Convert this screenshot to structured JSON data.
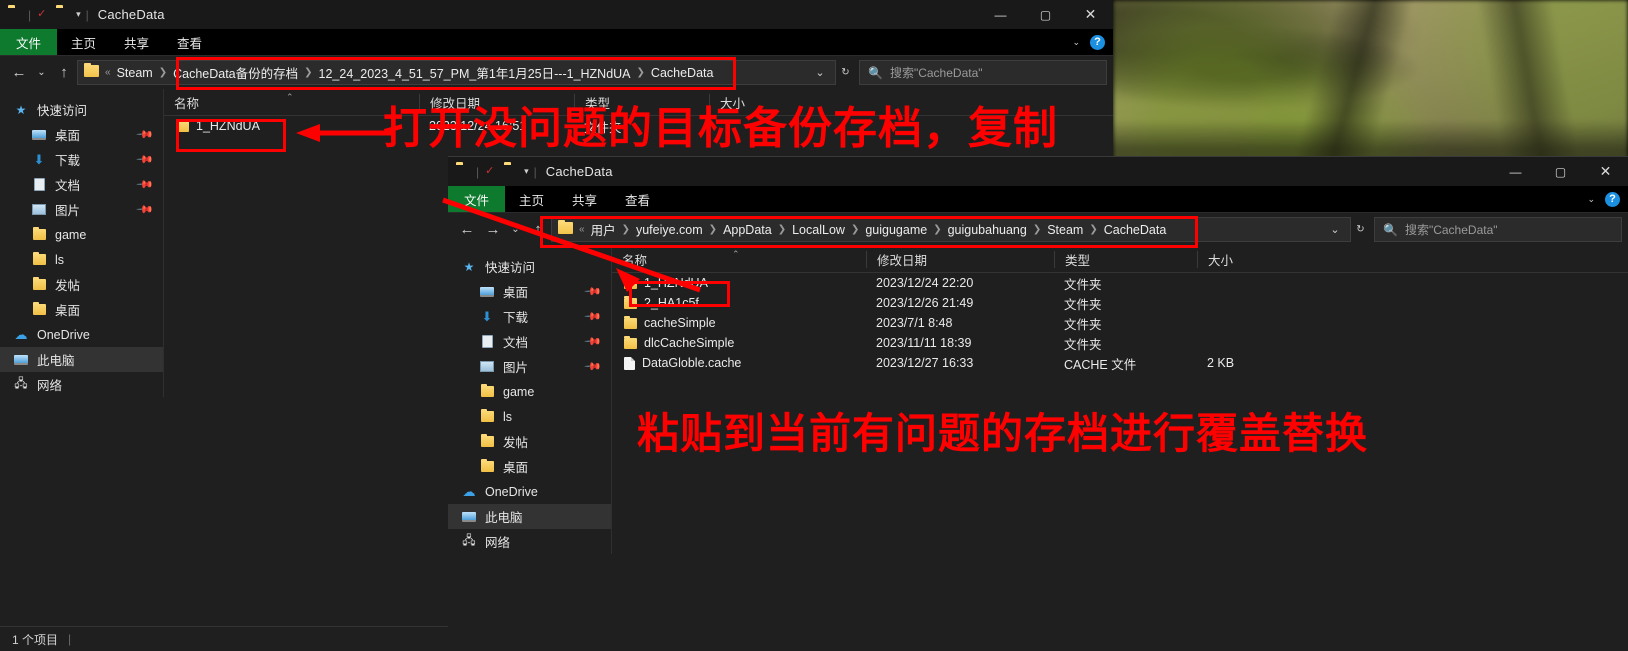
{
  "window1": {
    "title": "CacheData",
    "quick_access_icons": [
      "folder-icon",
      "properties-icon",
      "new-folder-icon",
      "customize-chevron-icon"
    ],
    "ribbon_tabs": [
      "文件",
      "主页",
      "共享",
      "查看"
    ],
    "window_buttons": {
      "minimize": "—",
      "maximize": "▢",
      "close": "✕"
    },
    "help_icon": "?",
    "nav": {
      "back": "←",
      "forward": "→",
      "recent": "⌄",
      "up": "↑"
    },
    "breadcrumbs": [
      "Steam",
      "CacheData备份的存档",
      "12_24_2023_4_51_57_PM_第1年1月25日---1_HZNdUA",
      "CacheData"
    ],
    "addr_prefix": "«",
    "addr_dropdown": "⌄",
    "refresh": "↻",
    "search_placeholder": "搜索\"CacheData\"",
    "sidebar": [
      {
        "label": "快速访问",
        "icon": "star-icon",
        "pinned": false,
        "indent": false,
        "selected": false
      },
      {
        "label": "桌面",
        "icon": "desktop-icon",
        "pinned": true,
        "indent": true,
        "selected": false
      },
      {
        "label": "下载",
        "icon": "download-icon",
        "pinned": true,
        "indent": true,
        "selected": false
      },
      {
        "label": "文档",
        "icon": "document-icon",
        "pinned": true,
        "indent": true,
        "selected": false
      },
      {
        "label": "图片",
        "icon": "pictures-icon",
        "pinned": true,
        "indent": true,
        "selected": false
      },
      {
        "label": "game",
        "icon": "folder-icon",
        "pinned": false,
        "indent": true,
        "selected": false
      },
      {
        "label": "ls",
        "icon": "folder-icon",
        "pinned": false,
        "indent": true,
        "selected": false
      },
      {
        "label": "发帖",
        "icon": "folder-icon",
        "pinned": false,
        "indent": true,
        "selected": false
      },
      {
        "label": "桌面",
        "icon": "folder-icon",
        "pinned": false,
        "indent": true,
        "selected": false
      },
      {
        "label": "OneDrive",
        "icon": "cloud-icon",
        "pinned": false,
        "indent": false,
        "selected": false
      },
      {
        "label": "此电脑",
        "icon": "this-pc-icon",
        "pinned": false,
        "indent": false,
        "selected": true
      },
      {
        "label": "网络",
        "icon": "network-icon",
        "pinned": false,
        "indent": false,
        "selected": false
      }
    ],
    "columns": [
      "名称",
      "修改日期",
      "类型",
      "大小"
    ],
    "rows": [
      {
        "name": "1_HZNdUA",
        "modified": "2023/12/24 16:51",
        "type": "文件夹",
        "size": "",
        "icon": "folder-icon",
        "highlighted": true
      }
    ],
    "status": {
      "count": "1 个项目",
      "extra": ""
    }
  },
  "window2": {
    "title": "CacheData",
    "ribbon_tabs": [
      "文件",
      "主页",
      "共享",
      "查看"
    ],
    "window_buttons": {
      "minimize": "—",
      "maximize": "▢",
      "close": "✕"
    },
    "help_icon": "?",
    "nav": {
      "back": "←",
      "forward": "→",
      "recent": "⌄",
      "up": "↑"
    },
    "breadcrumbs": [
      "用户",
      "yufeiye.com",
      "AppData",
      "LocalLow",
      "guigugame",
      "guigubahuang",
      "Steam",
      "CacheData"
    ],
    "addr_prefix": "«",
    "addr_dropdown": "⌄",
    "refresh": "↻",
    "search_placeholder": "搜索\"CacheData\"",
    "sidebar": [
      {
        "label": "快速访问",
        "icon": "star-icon",
        "pinned": false,
        "indent": false,
        "selected": false
      },
      {
        "label": "桌面",
        "icon": "desktop-icon",
        "pinned": true,
        "indent": true,
        "selected": false
      },
      {
        "label": "下载",
        "icon": "download-icon",
        "pinned": true,
        "indent": true,
        "selected": false
      },
      {
        "label": "文档",
        "icon": "document-icon",
        "pinned": true,
        "indent": true,
        "selected": false
      },
      {
        "label": "图片",
        "icon": "pictures-icon",
        "pinned": true,
        "indent": true,
        "selected": false
      },
      {
        "label": "game",
        "icon": "folder-icon",
        "pinned": false,
        "indent": true,
        "selected": false
      },
      {
        "label": "ls",
        "icon": "folder-icon",
        "pinned": false,
        "indent": true,
        "selected": false
      },
      {
        "label": "发帖",
        "icon": "folder-icon",
        "pinned": false,
        "indent": true,
        "selected": false
      },
      {
        "label": "桌面",
        "icon": "folder-icon",
        "pinned": false,
        "indent": true,
        "selected": false
      },
      {
        "label": "OneDrive",
        "icon": "cloud-icon",
        "pinned": false,
        "indent": false,
        "selected": false
      },
      {
        "label": "此电脑",
        "icon": "this-pc-icon",
        "pinned": false,
        "indent": false,
        "selected": true
      },
      {
        "label": "网络",
        "icon": "network-icon",
        "pinned": false,
        "indent": false,
        "selected": false
      }
    ],
    "columns": [
      "名称",
      "修改日期",
      "类型",
      "大小"
    ],
    "rows": [
      {
        "name": "1_HZNdUA",
        "modified": "2023/12/24 22:20",
        "type": "文件夹",
        "size": "",
        "icon": "folder-icon",
        "highlighted": true
      },
      {
        "name": "2_HA1c5f",
        "modified": "2023/12/26 21:49",
        "type": "文件夹",
        "size": "",
        "icon": "folder-icon",
        "highlighted": false
      },
      {
        "name": "cacheSimple",
        "modified": "2023/7/1 8:48",
        "type": "文件夹",
        "size": "",
        "icon": "folder-icon",
        "highlighted": false
      },
      {
        "name": "dlcCacheSimple",
        "modified": "2023/11/11 18:39",
        "type": "文件夹",
        "size": "",
        "icon": "folder-icon",
        "highlighted": false
      },
      {
        "name": "DataGloble.cache",
        "modified": "2023/12/27 16:33",
        "type": "CACHE 文件",
        "size": "2 KB",
        "icon": "file-icon",
        "highlighted": false
      }
    ]
  },
  "annotations": {
    "top_text": "打开没问题的目标备份存档，复制",
    "bottom_text": "粘贴到当前有问题的存档进行覆盖替换",
    "color": "#ff0000"
  }
}
